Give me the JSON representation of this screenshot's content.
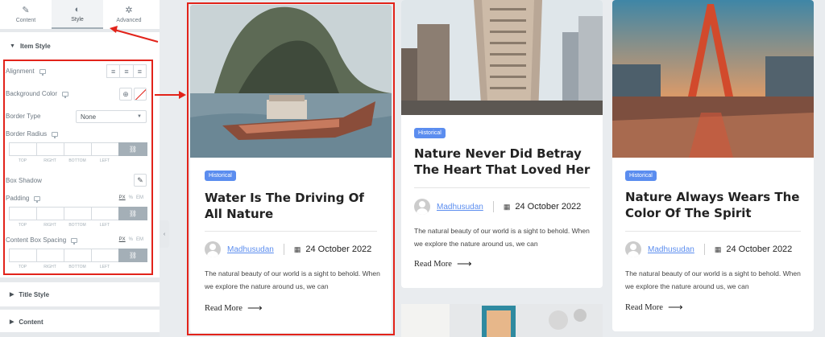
{
  "panel": {
    "tabs": [
      {
        "label": "Content",
        "icon": "pencil-icon"
      },
      {
        "label": "Style",
        "icon": "contrast-icon"
      },
      {
        "label": "Advanced",
        "icon": "gear-icon"
      }
    ],
    "item_style": {
      "heading": "Item Style",
      "alignment_label": "Alignment",
      "background_color_label": "Background Color",
      "border_type_label": "Border Type",
      "border_type_value": "None",
      "border_radius_label": "Border Radius",
      "box_shadow_label": "Box Shadow",
      "padding_label": "Padding",
      "content_box_spacing_label": "Content Box Spacing",
      "dim_labels": [
        "TOP",
        "RIGHT",
        "BOTTOM",
        "LEFT"
      ],
      "units": [
        "PX",
        "%",
        "EM"
      ]
    },
    "title_style_heading": "Title Style",
    "content_heading": "Content"
  },
  "cards": [
    {
      "badge": "Historical",
      "title": "Water Is The Driving Of All Nature",
      "author": "Madhusudan",
      "date": "24 October 2022",
      "excerpt": "The natural beauty of our world is a sight to behold. When we explore the nature around us, we can",
      "read_more": "Read More"
    },
    {
      "badge": "Historical",
      "title": "Nature Never Did Betray The Heart That Loved Her",
      "author": "Madhusudan",
      "date": "24 October 2022",
      "excerpt": "The natural beauty of our world is a sight to behold. When we explore the nature around us, we can",
      "read_more": "Read More"
    },
    {
      "badge": "Historical",
      "title": "Nature Always Wears The Color Of The Spirit",
      "author": "Madhusudan",
      "date": "24 October 2022",
      "excerpt": "The natural beauty of our world is a sight to behold. When we explore the nature around us, we can",
      "read_more": "Read More"
    }
  ],
  "colors": {
    "accent_blue": "#5b8def",
    "annotation_red": "#e2231a"
  }
}
